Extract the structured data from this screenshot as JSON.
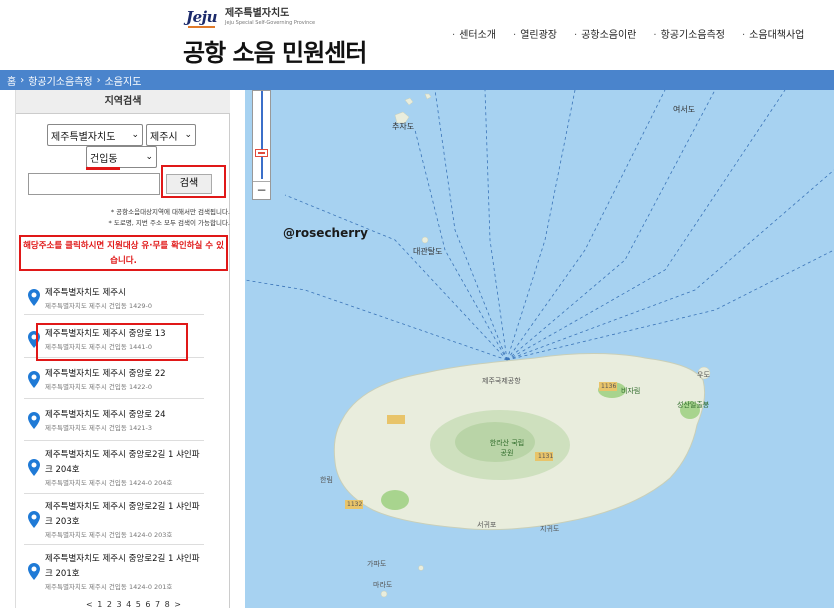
{
  "header": {
    "logo_mark": "Jeju",
    "logo_ko": "제주특별자치도",
    "logo_en": "Jeju Special Self-Governing Province",
    "site_title": "공항 소음 민원센터",
    "nav": [
      "센터소개",
      "열린광장",
      "공항소음이란",
      "항공기소음측정",
      "소음대책사업"
    ]
  },
  "breadcrumb": {
    "home": "홈",
    "items": [
      "항공기소음측정",
      "소음지도"
    ]
  },
  "sidebar": {
    "title": "지역검색",
    "province_select": "제주특별자치도",
    "city_select": "제주시",
    "dong_select": "건입동",
    "search_value": "",
    "search_button": "검색",
    "notes": [
      "* 공항소음대상지역에 대해서만 검색됩니다.",
      "* 도로명, 지번 주소 모두 검색이 가능합니다."
    ],
    "warning": "해당주소를 클릭하시면 지원대상 유·무를 확인하실 수 있습니다.",
    "results": [
      {
        "title": "제주특별자치도 제주시",
        "sub": "제주특별자치도 제주시 건입동 1429-0"
      },
      {
        "title": "제주특별자치도 제주시 중앙로 13",
        "sub": "제주특별자치도 제주시 건입동 1441-0"
      },
      {
        "title": "제주특별자치도 제주시 중앙로 22",
        "sub": "제주특별자치도 제주시 건입동 1422-0"
      },
      {
        "title": "제주특별자치도 제주시 중앙로 24",
        "sub": "제주특별자치도 제주시 건입동 1421-3"
      },
      {
        "title": "제주특별자치도 제주시 중앙로2길 1 샤인파크 204호",
        "sub": "제주특별자치도 제주시 건입동 1424-0 204호"
      },
      {
        "title": "제주특별자치도 제주시 중앙로2길 1 샤인파크 203호",
        "sub": "제주특별자치도 제주시 건입동 1424-0 203호"
      },
      {
        "title": "제주특별자치도 제주시 중앙로2길 1 샤인파크 201호",
        "sub": "제주특별자치도 제주시 건입동 1424-0 201호"
      }
    ],
    "pager": "< 1 2 3 4 5 6 7 8 >"
  },
  "map": {
    "watermark": "@rosecherry",
    "labels": {
      "chuja": "추자도",
      "daegwan": "대관탈도",
      "yeoseo": "여서도",
      "hallasan": "한라산 국립공원",
      "hallim": "한림",
      "jeju_airport": "제주국제공항",
      "marado": "마라도",
      "seogwipo": "서귀포",
      "seongsan": "성산일출봉",
      "udo": "우도",
      "jido": "지귀도",
      "gapado": "가파도",
      "bijarim": "비자림",
      "road_1136": "1136",
      "road_1131": "1131",
      "road_1132": "1132"
    }
  },
  "colors": {
    "accent_blue": "#4a84cc",
    "highlight_red": "#e01818",
    "sea": "#a7d2f1",
    "land": "#e9eddd",
    "pin_blue": "#1f7ad6"
  }
}
